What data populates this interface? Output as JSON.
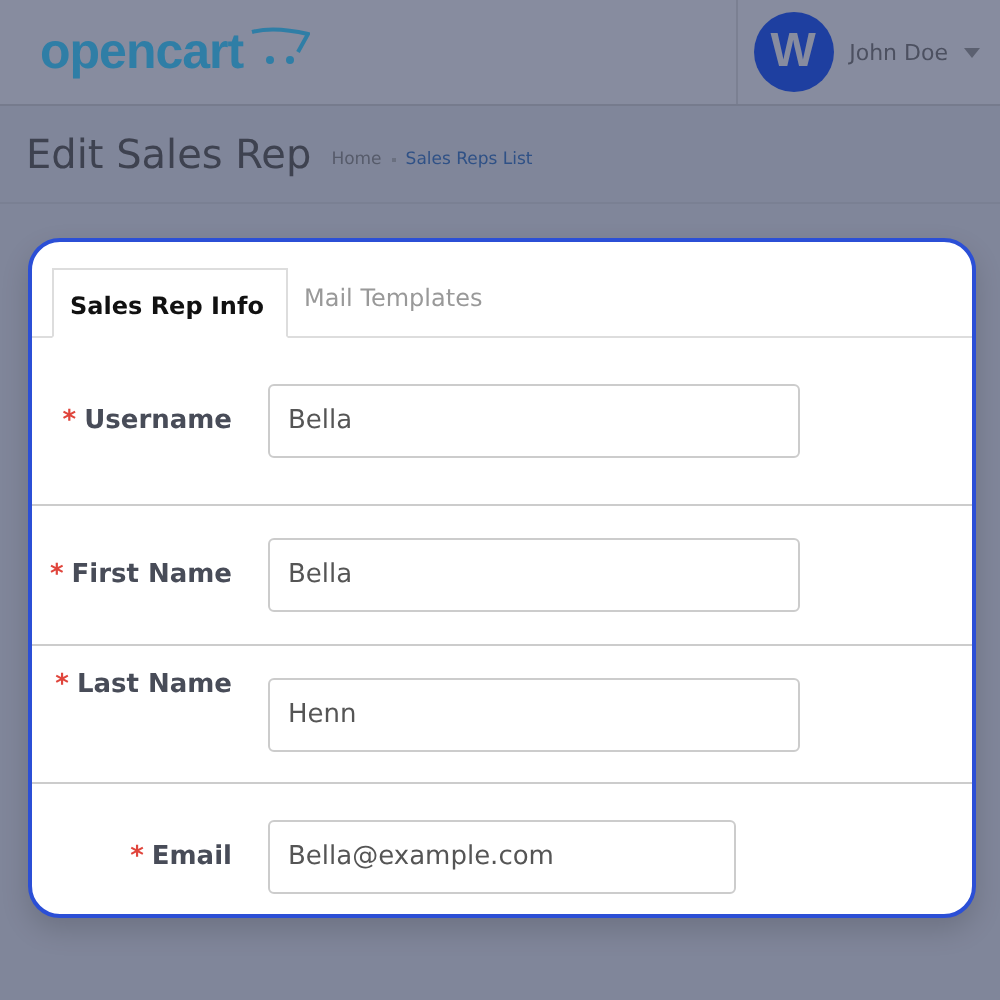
{
  "header": {
    "logo": "opencart",
    "avatar": "W",
    "user": "John Doe"
  },
  "page": {
    "title": "Edit Sales Rep",
    "breadcrumbs": [
      {
        "label": "Home",
        "kind": "plain"
      },
      {
        "label": "Sales Reps List",
        "kind": "link"
      }
    ]
  },
  "tabs": [
    {
      "label": "Sales Rep Info",
      "selected": true
    },
    {
      "label": "Mail Templates",
      "selected": false
    }
  ],
  "fields": [
    {
      "mark": "*",
      "label": "Username",
      "value": "Bella"
    },
    {
      "mark": "*",
      "label": "First Name",
      "value": "Bella"
    },
    {
      "mark": "*",
      "label": "Last Name",
      "value": "Henn"
    },
    {
      "mark": "*",
      "label": "Email",
      "value": "Bella@example.com"
    }
  ]
}
